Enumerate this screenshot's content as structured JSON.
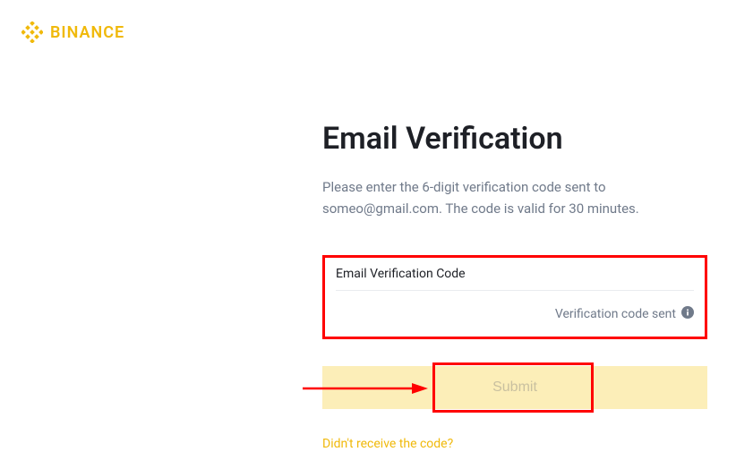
{
  "header": {
    "brand": "BINANCE"
  },
  "main": {
    "title": "Email Verification",
    "description": "Please enter the 6-digit verification code sent to someo@gmail.com. The code is valid for 30 minutes.",
    "input_label": "Email Verification Code",
    "input_status": "Verification code sent",
    "submit_label": "Submit",
    "resend_link": "Didn't receive the code?"
  },
  "colors": {
    "brand": "#F0B90B",
    "annotation": "#FF0000"
  }
}
